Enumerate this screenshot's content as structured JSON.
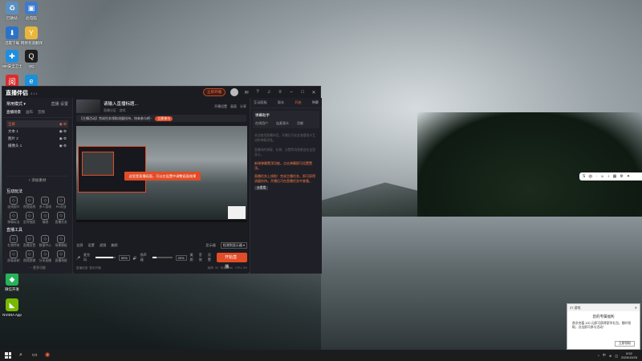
{
  "desktop": {
    "icons": [
      {
        "label": "回收站",
        "glyph": "♻",
        "color": "#5a8fc0"
      },
      {
        "label": "此电脑",
        "glyph": "▣",
        "color": "#3d7bd0"
      },
      {
        "label": "迅雷下载",
        "glyph": "⬇",
        "color": "#2a73c9"
      },
      {
        "label": "网易有道翻译",
        "glyph": "Y",
        "color": "#e8b73a"
      },
      {
        "label": "360安全卫士",
        "glyph": "✚",
        "color": "#1e8ee0"
      },
      {
        "label": "QQ",
        "glyph": "Q",
        "color": "#1e1e1e"
      },
      {
        "label": "云阅读",
        "glyph": "阅",
        "color": "#d92d2d"
      },
      {
        "label": "Microsoft Edge",
        "glyph": "e",
        "color": "#1b8fd8"
      },
      {
        "label": "微信开发",
        "glyph": "◆",
        "color": "#27b35a"
      },
      {
        "label": "NVIDIA App",
        "glyph": "◣",
        "color": "#76b900"
      }
    ]
  },
  "app": {
    "title": "直播伴侣",
    "version": "4.1.1",
    "hot_label": "立即开播",
    "titlebar_icons": [
      "message-icon",
      "help-icon",
      "headset-icon",
      "menu-icon",
      "minimize-icon",
      "maximize-icon",
      "close-icon"
    ],
    "left": {
      "heading": "常用模式",
      "heading_right": [
        "直播",
        "设置"
      ],
      "tabs": [
        "直播场景",
        "画布",
        "音频"
      ],
      "scenes": [
        {
          "label": "全屏",
          "active": true
        },
        {
          "label": "文本 1",
          "active": false
        },
        {
          "label": "图片 2",
          "active": false
        },
        {
          "label": "摄像头 1",
          "active": false
        }
      ],
      "add_source": "+ 添加素材",
      "interact_title": "互动玩法",
      "interact_tools": [
        "连线观众",
        "视频连线",
        "多人游戏",
        "PK对战",
        "弹幕玩法",
        "定时抽奖",
        "福袋",
        "直播任务"
      ],
      "tools_title": "直播工具",
      "tools": [
        "礼物特效",
        "直播设置",
        "数据中心",
        "场景模板",
        "屏幕录制",
        "视频剪辑",
        "分享直播",
        "直播海报"
      ],
      "more": "··· 更多功能"
    },
    "center": {
      "room_title": "请输入直播标题...",
      "room_sub": "直播分区 · 游戏",
      "room_right": [
        "开播设置",
        "画面",
        "分享"
      ],
      "banner_text": "【主播活动】完成任务领取流量扶持，快来参与吧~",
      "banner_action": "立即参与",
      "preview_toast": "这里是直播画面，可以在设置中调整画面效果",
      "controls": [
        "全屏",
        "设置",
        "滤镜",
        "美颜"
      ],
      "display_label": "显示器",
      "display_value": "检测到显示器",
      "mic_label": "麦克风",
      "mic_pct": "90%",
      "spk_label": "扬声器",
      "spk_pct": "20%",
      "actions": [
        "美颜",
        "音效",
        "设置"
      ],
      "start_label": "开始直播",
      "status_left": "直播信息: 暂未开播",
      "status_right": "帧率: 30 · 码率: 0kb · CPU: 2%"
    },
    "right": {
      "tabs": [
        "互动面板",
        "观众",
        "开启",
        "弹幕"
      ],
      "card_title": "弹幕助手",
      "card_sub": [
        "在线用户",
        "连麦观众",
        "贡献"
      ],
      "hint1": "欢迎使用直播伴侣，开播后可在此查看观众互动和弹幕消息。",
      "hint2": "直播间的弹幕、礼物、点赞等消息都会在这里显示。",
      "orange1": "新增弹幕置顶功能，点击弹幕即可设置置顶。",
      "orange2": "直播任务上线啦！完成主播任务，即可获得流量扶持。开播后可在直播任务中查看。",
      "btn": "去看看"
    }
  },
  "floatbar": {
    "items": [
      "S",
      "中",
      "·",
      "☺",
      "♪",
      "▦",
      "⚙",
      "✦"
    ]
  },
  "popup": {
    "title_bar": "37 游戏",
    "title": "您的专属福利",
    "body": "首次充值 100 元即可获得豪华礼包，限时领取，点击即可参与活动！",
    "button": "立即领取"
  },
  "taskbar": {
    "time": "9:52",
    "date": "2025/10/25",
    "tray": [
      "^",
      "中",
      "⊕",
      "◫"
    ]
  }
}
